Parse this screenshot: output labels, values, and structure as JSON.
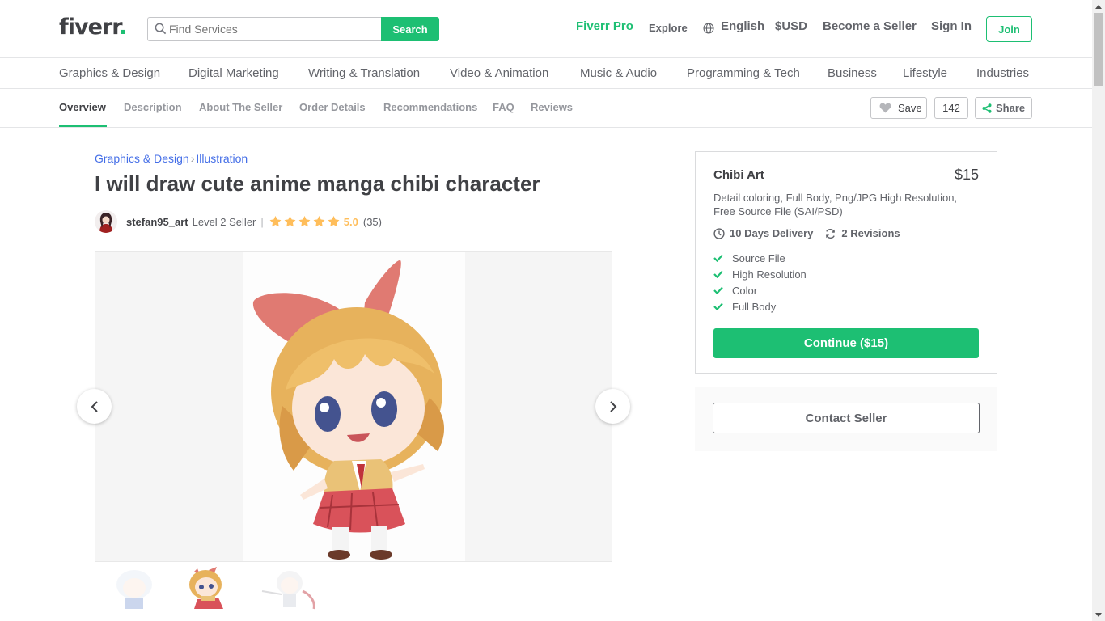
{
  "header": {
    "logo_text": "fiverr",
    "logo_dot": ".",
    "search_placeholder": "Find Services",
    "search_button": "Search",
    "fiverr_pro": "Fiverr Pro",
    "explore": "Explore",
    "language": "English",
    "currency": "$USD",
    "become_seller": "Become a Seller",
    "sign_in": "Sign In",
    "join": "Join"
  },
  "categories": [
    "Graphics & Design",
    "Digital Marketing",
    "Writing & Translation",
    "Video & Animation",
    "Music & Audio",
    "Programming & Tech",
    "Business",
    "Lifestyle",
    "Industries"
  ],
  "subnav": {
    "items": [
      "Overview",
      "Description",
      "About The Seller",
      "Order Details",
      "Recommendations",
      "FAQ",
      "Reviews"
    ],
    "save_label": "Save",
    "save_count": "142",
    "share_label": "Share"
  },
  "gig": {
    "breadcrumb": [
      "Graphics & Design",
      "Illustration"
    ],
    "breadcrumb_sep": "›",
    "title": "I will draw cute anime manga chibi character",
    "seller_name": "stefan95_art",
    "seller_level": "Level 2 Seller",
    "divider": "|",
    "rating": "5.0",
    "rating_count": "(35)",
    "stars": 5
  },
  "package": {
    "title": "Chibi Art",
    "price": "$15",
    "description": "Detail coloring, Full Body, Png/JPG High Resolution, Free Source File (SAI/PSD)",
    "delivery": "10 Days Delivery",
    "revisions": "2 Revisions",
    "features": [
      "Source File",
      "High Resolution",
      "Color",
      "Full Body"
    ],
    "continue_button": "Continue ($15)",
    "contact_button": "Contact Seller"
  },
  "colors": {
    "brand_green": "#1dbf73",
    "link_blue": "#446ee7",
    "star_yellow": "#ffbe5b"
  }
}
